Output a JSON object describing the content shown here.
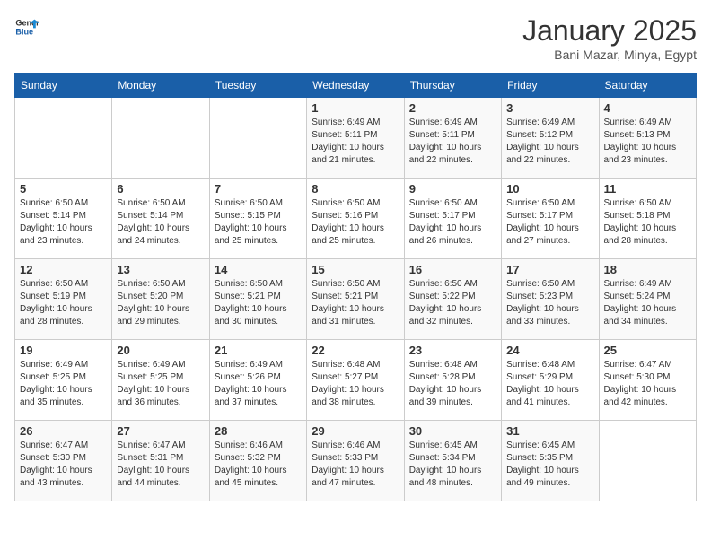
{
  "logo": {
    "line1": "General",
    "line2": "Blue"
  },
  "title": "January 2025",
  "subtitle": "Bani Mazar, Minya, Egypt",
  "weekdays": [
    "Sunday",
    "Monday",
    "Tuesday",
    "Wednesday",
    "Thursday",
    "Friday",
    "Saturday"
  ],
  "weeks": [
    [
      {
        "day": "",
        "info": ""
      },
      {
        "day": "",
        "info": ""
      },
      {
        "day": "",
        "info": ""
      },
      {
        "day": "1",
        "info": "Sunrise: 6:49 AM\nSunset: 5:11 PM\nDaylight: 10 hours\nand 21 minutes."
      },
      {
        "day": "2",
        "info": "Sunrise: 6:49 AM\nSunset: 5:11 PM\nDaylight: 10 hours\nand 22 minutes."
      },
      {
        "day": "3",
        "info": "Sunrise: 6:49 AM\nSunset: 5:12 PM\nDaylight: 10 hours\nand 22 minutes."
      },
      {
        "day": "4",
        "info": "Sunrise: 6:49 AM\nSunset: 5:13 PM\nDaylight: 10 hours\nand 23 minutes."
      }
    ],
    [
      {
        "day": "5",
        "info": "Sunrise: 6:50 AM\nSunset: 5:14 PM\nDaylight: 10 hours\nand 23 minutes."
      },
      {
        "day": "6",
        "info": "Sunrise: 6:50 AM\nSunset: 5:14 PM\nDaylight: 10 hours\nand 24 minutes."
      },
      {
        "day": "7",
        "info": "Sunrise: 6:50 AM\nSunset: 5:15 PM\nDaylight: 10 hours\nand 25 minutes."
      },
      {
        "day": "8",
        "info": "Sunrise: 6:50 AM\nSunset: 5:16 PM\nDaylight: 10 hours\nand 25 minutes."
      },
      {
        "day": "9",
        "info": "Sunrise: 6:50 AM\nSunset: 5:17 PM\nDaylight: 10 hours\nand 26 minutes."
      },
      {
        "day": "10",
        "info": "Sunrise: 6:50 AM\nSunset: 5:17 PM\nDaylight: 10 hours\nand 27 minutes."
      },
      {
        "day": "11",
        "info": "Sunrise: 6:50 AM\nSunset: 5:18 PM\nDaylight: 10 hours\nand 28 minutes."
      }
    ],
    [
      {
        "day": "12",
        "info": "Sunrise: 6:50 AM\nSunset: 5:19 PM\nDaylight: 10 hours\nand 28 minutes."
      },
      {
        "day": "13",
        "info": "Sunrise: 6:50 AM\nSunset: 5:20 PM\nDaylight: 10 hours\nand 29 minutes."
      },
      {
        "day": "14",
        "info": "Sunrise: 6:50 AM\nSunset: 5:21 PM\nDaylight: 10 hours\nand 30 minutes."
      },
      {
        "day": "15",
        "info": "Sunrise: 6:50 AM\nSunset: 5:21 PM\nDaylight: 10 hours\nand 31 minutes."
      },
      {
        "day": "16",
        "info": "Sunrise: 6:50 AM\nSunset: 5:22 PM\nDaylight: 10 hours\nand 32 minutes."
      },
      {
        "day": "17",
        "info": "Sunrise: 6:50 AM\nSunset: 5:23 PM\nDaylight: 10 hours\nand 33 minutes."
      },
      {
        "day": "18",
        "info": "Sunrise: 6:49 AM\nSunset: 5:24 PM\nDaylight: 10 hours\nand 34 minutes."
      }
    ],
    [
      {
        "day": "19",
        "info": "Sunrise: 6:49 AM\nSunset: 5:25 PM\nDaylight: 10 hours\nand 35 minutes."
      },
      {
        "day": "20",
        "info": "Sunrise: 6:49 AM\nSunset: 5:25 PM\nDaylight: 10 hours\nand 36 minutes."
      },
      {
        "day": "21",
        "info": "Sunrise: 6:49 AM\nSunset: 5:26 PM\nDaylight: 10 hours\nand 37 minutes."
      },
      {
        "day": "22",
        "info": "Sunrise: 6:48 AM\nSunset: 5:27 PM\nDaylight: 10 hours\nand 38 minutes."
      },
      {
        "day": "23",
        "info": "Sunrise: 6:48 AM\nSunset: 5:28 PM\nDaylight: 10 hours\nand 39 minutes."
      },
      {
        "day": "24",
        "info": "Sunrise: 6:48 AM\nSunset: 5:29 PM\nDaylight: 10 hours\nand 41 minutes."
      },
      {
        "day": "25",
        "info": "Sunrise: 6:47 AM\nSunset: 5:30 PM\nDaylight: 10 hours\nand 42 minutes."
      }
    ],
    [
      {
        "day": "26",
        "info": "Sunrise: 6:47 AM\nSunset: 5:30 PM\nDaylight: 10 hours\nand 43 minutes."
      },
      {
        "day": "27",
        "info": "Sunrise: 6:47 AM\nSunset: 5:31 PM\nDaylight: 10 hours\nand 44 minutes."
      },
      {
        "day": "28",
        "info": "Sunrise: 6:46 AM\nSunset: 5:32 PM\nDaylight: 10 hours\nand 45 minutes."
      },
      {
        "day": "29",
        "info": "Sunrise: 6:46 AM\nSunset: 5:33 PM\nDaylight: 10 hours\nand 47 minutes."
      },
      {
        "day": "30",
        "info": "Sunrise: 6:45 AM\nSunset: 5:34 PM\nDaylight: 10 hours\nand 48 minutes."
      },
      {
        "day": "31",
        "info": "Sunrise: 6:45 AM\nSunset: 5:35 PM\nDaylight: 10 hours\nand 49 minutes."
      },
      {
        "day": "",
        "info": ""
      }
    ]
  ]
}
